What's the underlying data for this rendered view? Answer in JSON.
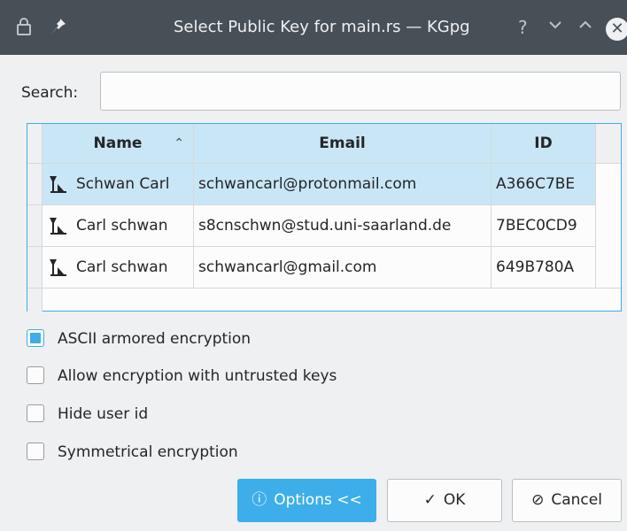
{
  "titlebar": {
    "title": "Select Public Key for main.rs — KGpg",
    "lock_icon": "lock-icon",
    "pin_icon": "pin-icon",
    "help_label": "?",
    "minimize_label": "⌄",
    "maximize_label": "^",
    "close_label": "✕"
  },
  "search": {
    "label": "Search:",
    "value": "",
    "placeholder": ""
  },
  "table": {
    "columns": [
      "Name",
      "Email",
      "ID"
    ],
    "sort_column": "Name",
    "sort_direction": "ascending",
    "sort_glyph": "⌃",
    "rows": [
      {
        "name": "Schwan Carl",
        "email": "schwancarl@protonmail.com",
        "id": "A366C7BE",
        "selected": true
      },
      {
        "name": "Carl schwan",
        "email": "s8cnschwn@stud.uni-saarland.de",
        "id": "7BEC0CD9",
        "selected": false
      },
      {
        "name": "Carl schwan",
        "email": "schwancarl@gmail.com",
        "id": "649B780A",
        "selected": false
      }
    ]
  },
  "options": [
    {
      "label": "ASCII armored encryption",
      "checked": true
    },
    {
      "label": "Allow encryption with untrusted keys",
      "checked": false
    },
    {
      "label": "Hide user id",
      "checked": false
    },
    {
      "label": "Symmetrical encryption",
      "checked": false
    }
  ],
  "buttons": {
    "options_label": "Options <<",
    "options_icon": "ⓘ",
    "ok_label": "OK",
    "ok_icon": "✓",
    "cancel_label": "Cancel",
    "cancel_icon": "⊘"
  },
  "colors": {
    "accent": "#3daee9",
    "selection": "#c9e6f6",
    "titlebar": "#475057",
    "window": "#eff0f1"
  }
}
